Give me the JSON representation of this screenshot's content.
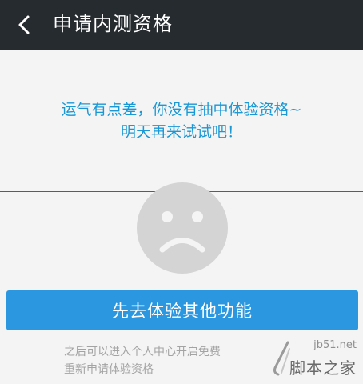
{
  "topbar": {
    "back_icon": "chevron-left-icon",
    "title": "申请内测资格"
  },
  "message": {
    "line1": "运气有点差，你没有抽中体验资格~",
    "line2": "明天再来试试吧！",
    "color": "#1a98d5"
  },
  "illustration": {
    "icon": "sad-face-icon",
    "color": "#d4d4d4"
  },
  "primary_button": {
    "label": "先去体验其他功能",
    "color": "#2a97e0"
  },
  "hint": {
    "line1": "之后可以进入个人中心开启免费",
    "line2": "重新申请体验资格"
  },
  "watermark": {
    "url": "jb51.net",
    "name": "脚本之家"
  }
}
